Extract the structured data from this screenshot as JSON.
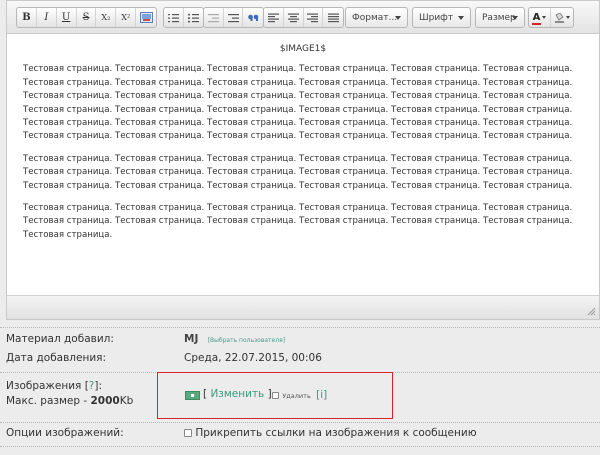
{
  "toolbar": {
    "bold": "B",
    "italic": "I",
    "underline": "U",
    "strike": "S",
    "subscript": "X₂",
    "superscript": "X²",
    "format_label": "Формат...",
    "font_label": "Шрифт",
    "size_label": "Размер",
    "text_color_letter": "A"
  },
  "editor": {
    "image_token": "$IMAGE1$",
    "paragraphs": [
      "Тестовая страница. Тестовая страница. Тестовая страница. Тестовая страница. Тестовая страница. Тестовая страница. Тестовая страница. Тестовая страница. Тестовая страница. Тестовая страница. Тестовая страница. Тестовая страница. Тестовая страница. Тестовая страница. Тестовая страница. Тестовая страница. Тестовая страница. Тестовая страница. Тестовая страница. Тестовая страница. Тестовая страница. Тестовая страница. Тестовая страница. Тестовая страница. Тестовая страница. Тестовая страница. Тестовая страница. Тестовая страница. Тестовая страница. Тестовая страница. Тестовая страница. Тестовая страница. Тестовая страница. Тестовая страница. Тестовая страница. Тестовая страница.",
      "Тестовая страница. Тестовая страница. Тестовая страница. Тестовая страница. Тестовая страница. Тестовая страница. Тестовая страница. Тестовая страница. Тестовая страница. Тестовая страница. Тестовая страница. Тестовая страница. Тестовая страница. Тестовая страница. Тестовая страница. Тестовая страница. Тестовая страница. Тестовая страница.",
      "Тестовая страница. Тестовая страница. Тестовая страница. Тестовая страница. Тестовая страница. Тестовая страница. Тестовая страница. Тестовая страница. Тестовая страница. Тестовая страница. Тестовая страница. Тестовая страница. Тестовая страница."
    ]
  },
  "form": {
    "author_label": "Материал добавил:",
    "author_value": "MJ",
    "choose_user_link": "[Выбрать пользователя]",
    "date_label": "Дата добавления:",
    "date_value": "Среда, 22.07.2015, 00:06",
    "images_label": "Изображения [",
    "images_help": "?",
    "images_label_end": "]:",
    "max_size_label": "Макс. размер - ",
    "max_size_value": "2000",
    "max_size_unit": "Kb",
    "change_open": "[ ",
    "change_link": "Изменить",
    "change_close": " ]",
    "delete_label": "Удалить",
    "info_link": "[i]",
    "image_options_label": "Опции изображений:",
    "attach_links_label": "Прикрепить ссылки на изображения к сообщению"
  },
  "colors": {
    "highlight_border": "#d8212a",
    "link": "#3c9a7e",
    "upload_button": "#5aa87d"
  },
  "icons": [
    "image-icon",
    "numbered-list-icon",
    "bullet-list-icon",
    "outdent-icon",
    "indent-icon",
    "blockquote-icon",
    "align-left-icon",
    "align-center-icon",
    "align-right-icon",
    "justify-icon",
    "text-color-icon",
    "background-color-icon",
    "resize-grip-icon",
    "upload-icon"
  ]
}
